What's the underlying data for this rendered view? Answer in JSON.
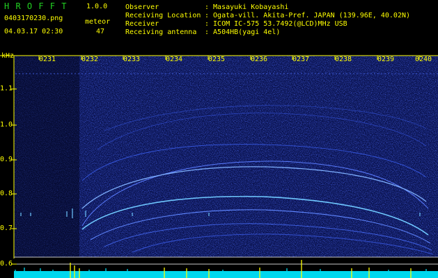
{
  "header": {
    "app_name": "H R O F F T",
    "version": "1.0.0",
    "filename": "0403170230.png",
    "meteor_label": "meteor",
    "datetime": "04.03.17 02:30",
    "meteor_count": "47",
    "fields": [
      {
        "label": "Observer",
        "value": ": Masayuki Kobayashi"
      },
      {
        "label": "Receiving Location",
        "value": ": Ogata-vill. Akita-Pref. JAPAN (139.96E, 40.02N)"
      },
      {
        "label": "Receiver",
        "value": ": ICOM IC-575 53.7492(@LCD)MHz USB"
      },
      {
        "label": "Receiving antenna",
        "value": ": A504HB(yagi 4el)"
      }
    ]
  },
  "spectrogram": {
    "y_unit": "kHz",
    "y_ticks": [
      "1.1",
      "1.0",
      "0.9",
      "0.8",
      "0.7",
      "0.6"
    ],
    "time_labels": [
      "0231",
      "0232",
      "0233",
      "0234",
      "0235",
      "0236",
      "0237",
      "0238",
      "0239",
      "0240"
    ]
  },
  "colors": {
    "background": "#000000",
    "noise": "#1a2ab0",
    "trace": "#6fc8ff",
    "marker": "#ffff00",
    "power": "#00e0f0"
  }
}
